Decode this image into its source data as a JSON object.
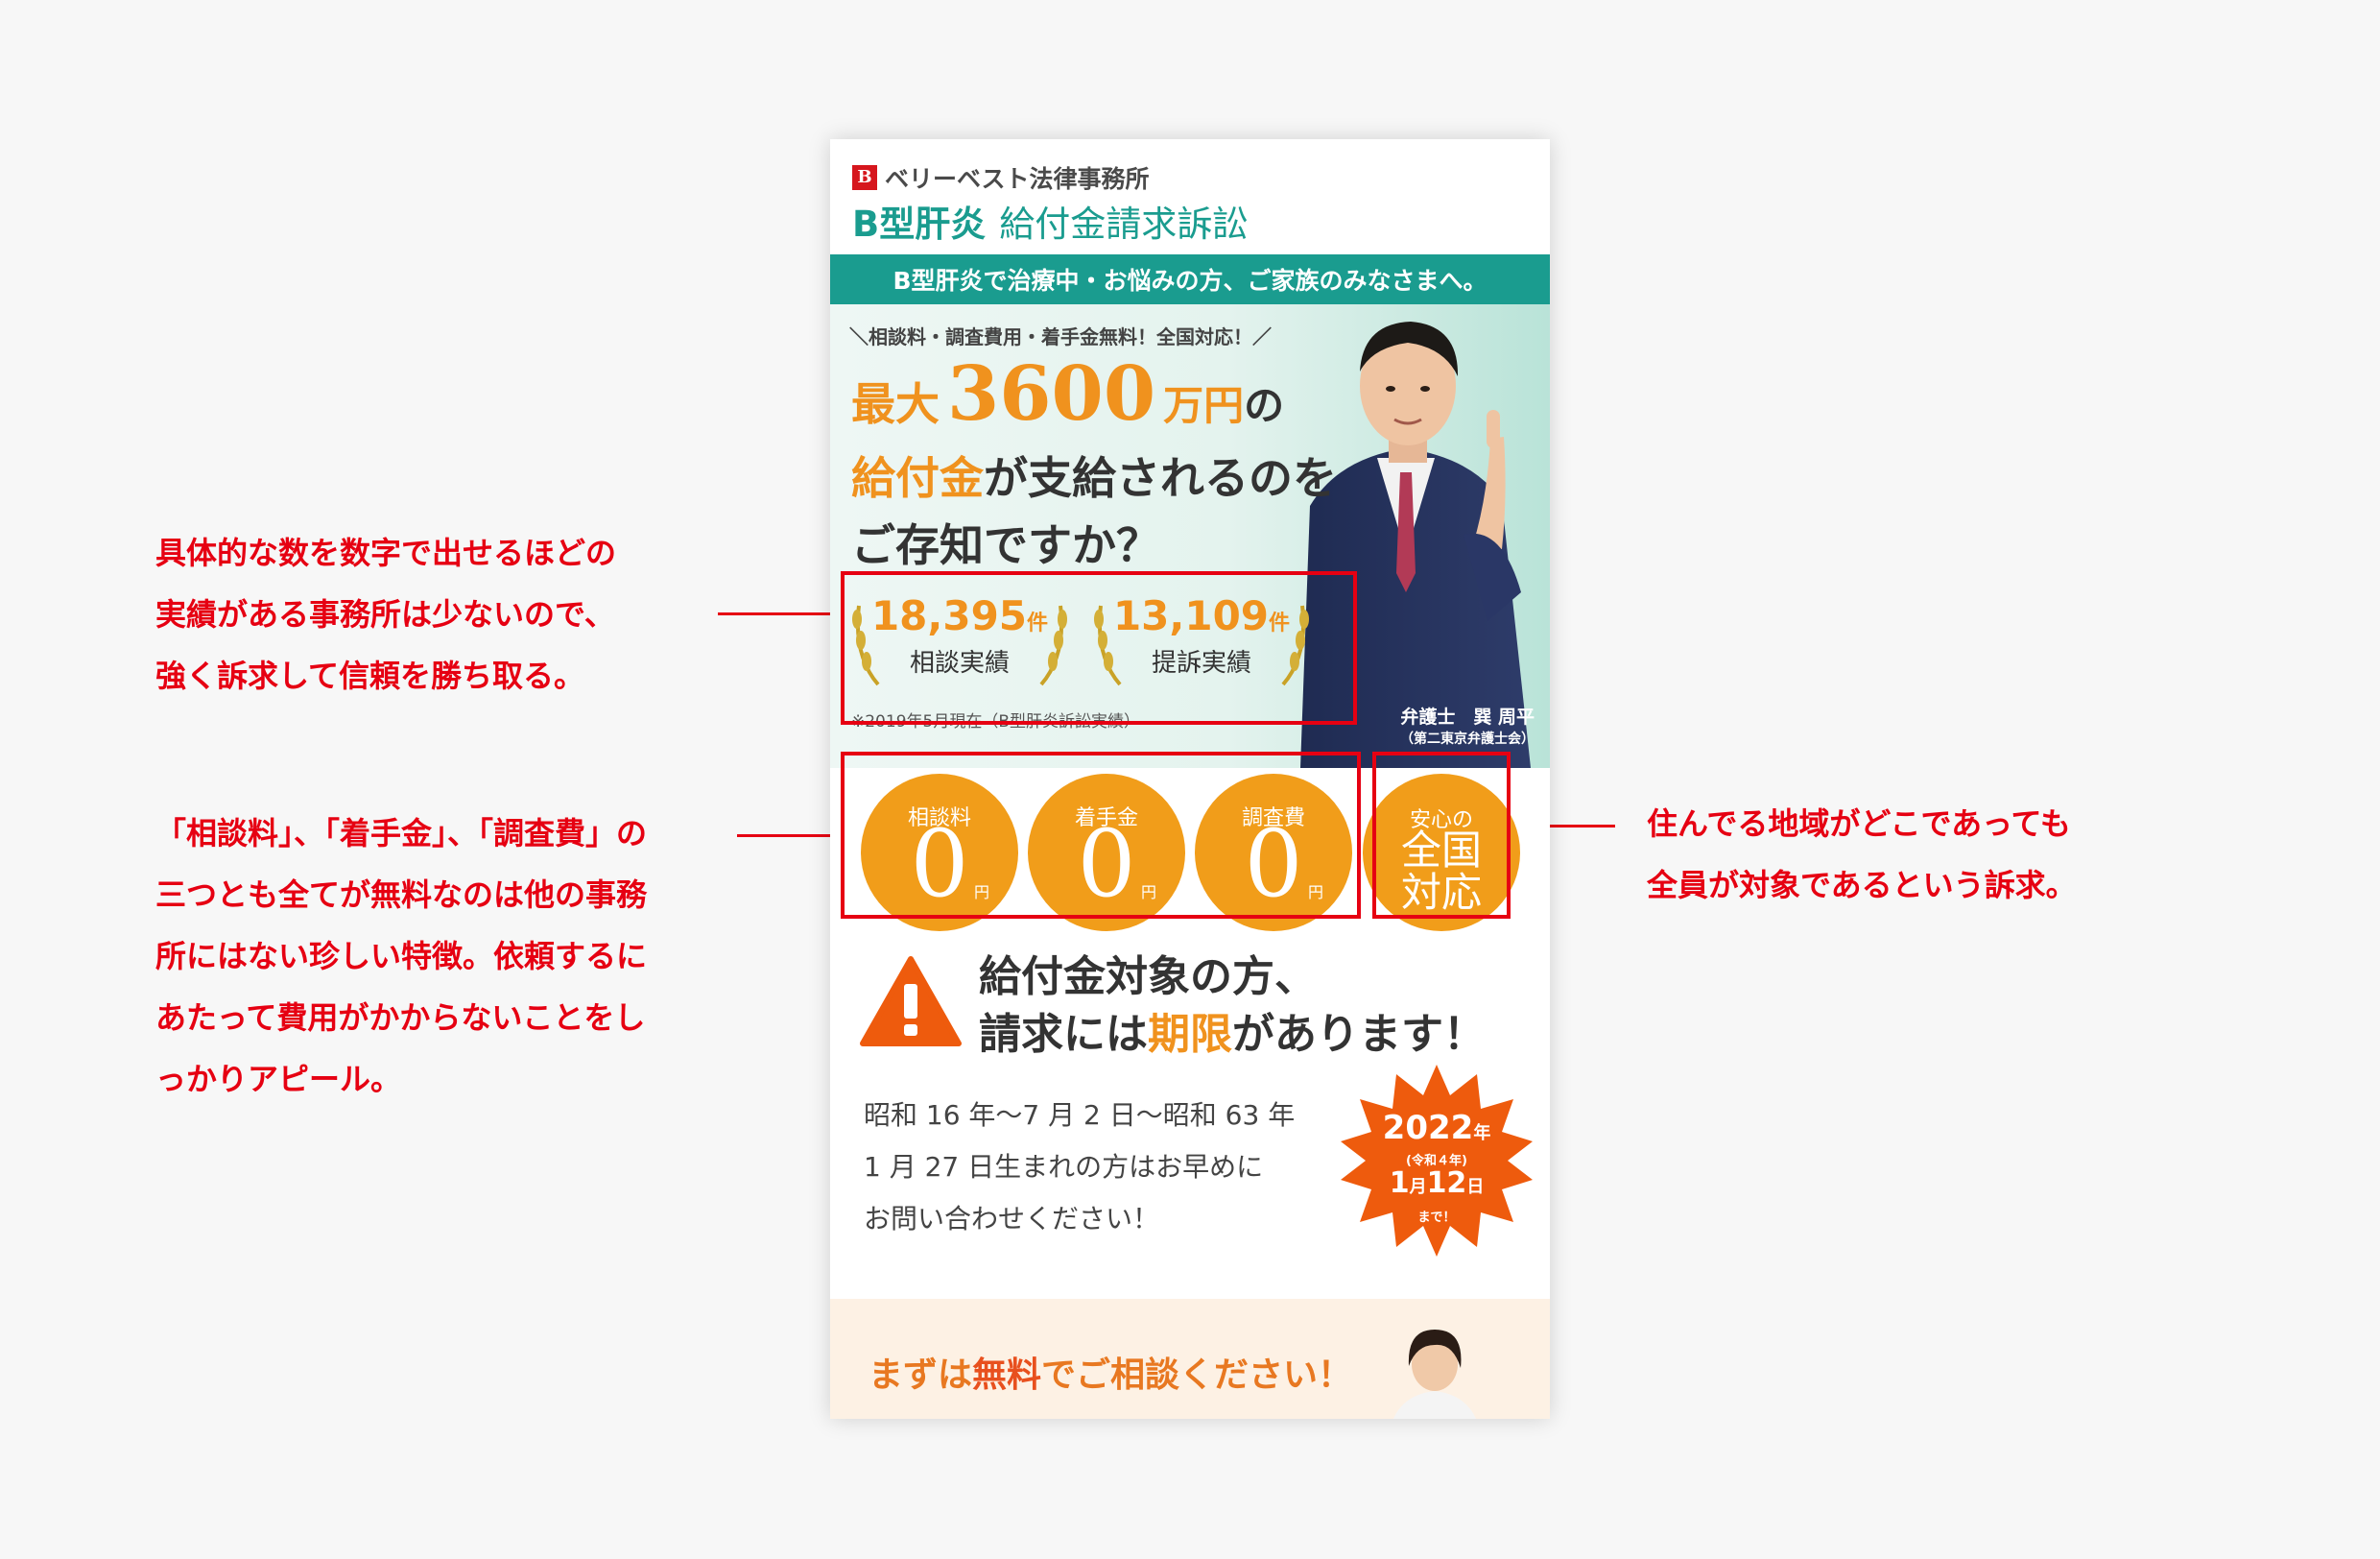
{
  "firm": {
    "logo_mark": "B",
    "name": "ベリーベスト法律事務所",
    "title_strong": "B型肝炎",
    "title_light": "給付金請求訴訟"
  },
  "band_text": "B型肝炎で治療中・お悩みの方、ご家族のみなさまへ。",
  "hero": {
    "tagline": "＼相談料・調査費用・着手金無料！全国対応！／",
    "max_label": "最大",
    "amount": "3600",
    "unit": "万円",
    "no": "の",
    "line2_highlight": "給付金",
    "line2_rest": "が支給されるのを",
    "line3": "ご存知ですか？",
    "stats": [
      {
        "number": "18,395",
        "unit": "件",
        "label": "相談実績"
      },
      {
        "number": "13,109",
        "unit": "件",
        "label": "提訴実績"
      }
    ],
    "note": "※2019年5月現在（B型肝炎訴訟実績）",
    "lawyer_name": "弁護士　巽 周平",
    "lawyer_affiliation": "（第二東京弁護士会）"
  },
  "badges": [
    {
      "label": "相談料",
      "value": "0",
      "unit": "円"
    },
    {
      "label": "着手金",
      "value": "0",
      "unit": "円"
    },
    {
      "label": "調査費",
      "value": "0",
      "unit": "円"
    }
  ],
  "area_badge": {
    "small": "安心の",
    "line1": "全国",
    "line2": "対応"
  },
  "warning": {
    "line1": "給付金対象の方、",
    "line2_pre": "請求には",
    "line2_highlight": "期限",
    "line2_post": "があります！"
  },
  "dates": [
    "昭和 16 年〜7 月 2 日〜昭和 63 年",
    "1 月 27 日生まれの方はお早めに",
    "お問い合わせください！"
  ],
  "deadline": {
    "year": "2022",
    "year_unit": "年",
    "era": "(令和４年)",
    "month": "1",
    "month_unit": "月",
    "day": "12",
    "day_unit": "日",
    "until": "まで！"
  },
  "cta": {
    "pre": "まずは",
    "highlight": "無料",
    "post": "でご相談ください！"
  },
  "annotations": {
    "left_top": [
      "具体的な数を数字で出せるほどの",
      "実績がある事務所は少ないので、",
      "強く訴求して信頼を勝ち取る。"
    ],
    "left_bottom": [
      "「相談料」、「着手金」、「調査費」の",
      "三つとも全てが無料なのは他の事務",
      "所にはない珍しい特徴。依頼するに",
      "あたって費用がかからないことをし",
      "っかりアピール。"
    ],
    "right": [
      "住んでる地域がどこであっても",
      "全員が対象であるという訴求。"
    ]
  },
  "colors": {
    "accent_red": "#e60012",
    "teal": "#1a9c8f",
    "orange": "#f19d1a",
    "deadline_orange": "#ee5b0d"
  }
}
